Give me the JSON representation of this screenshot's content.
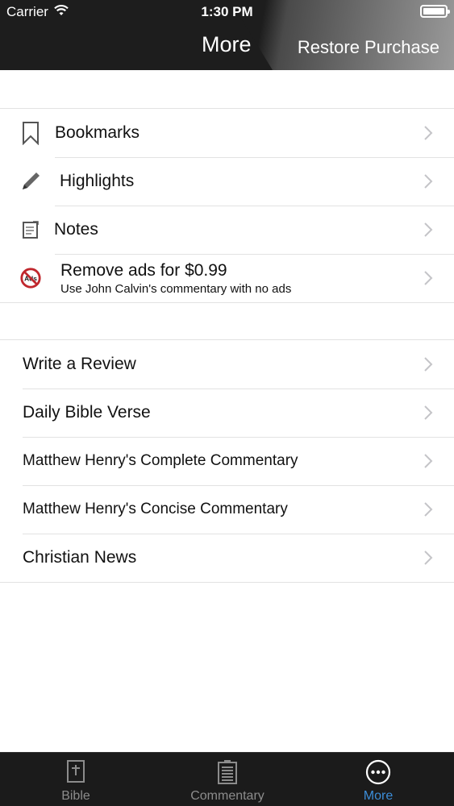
{
  "status_bar": {
    "carrier": "Carrier",
    "time": "1:30 PM"
  },
  "nav": {
    "title": "More",
    "restore_button": "Restore Purchase"
  },
  "group1": [
    {
      "label": "Bookmarks",
      "icon": "bookmark-icon"
    },
    {
      "label": "Highlights",
      "icon": "pencil-icon"
    },
    {
      "label": "Notes",
      "icon": "notes-icon"
    },
    {
      "label": "Remove ads for $0.99",
      "sublabel": "Use John Calvin's commentary with no ads",
      "icon": "no-ads-icon"
    }
  ],
  "group2": [
    {
      "label": "Write a Review"
    },
    {
      "label": "Daily Bible Verse"
    },
    {
      "label": "Matthew Henry's Complete Commentary"
    },
    {
      "label": "Matthew Henry's Concise Commentary"
    },
    {
      "label": "Christian News"
    }
  ],
  "tabbar": {
    "tabs": [
      {
        "label": "Bible",
        "icon": "bible-icon",
        "active": false
      },
      {
        "label": "Commentary",
        "icon": "commentary-icon",
        "active": false
      },
      {
        "label": "More",
        "icon": "more-icon",
        "active": true
      }
    ]
  },
  "colors": {
    "header_bg": "#1d1d1d",
    "accent": "#3c8dd8",
    "tabbar_bg": "#1b1b1b"
  }
}
